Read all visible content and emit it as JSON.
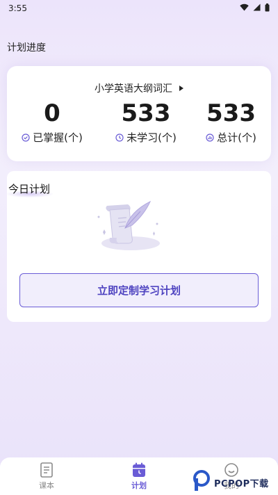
{
  "status_bar": {
    "time": "3:55",
    "icons": [
      "wifi-icon",
      "cellular-signal-icon",
      "battery-icon"
    ]
  },
  "progress_section": {
    "title": "计划进度",
    "book_name": "小学英语大纲词汇",
    "stats": [
      {
        "value": "0",
        "label": "已掌握(个)",
        "icon": "check-circle-icon"
      },
      {
        "value": "533",
        "label": "未学习(个)",
        "icon": "clock-icon"
      },
      {
        "value": "533",
        "label": "总计(个)",
        "icon": "bar-chart-icon"
      }
    ]
  },
  "today_plan": {
    "title": "今日计划",
    "illustration": "scroll-quill-icon",
    "button_label": "立即定制学习计划"
  },
  "bottom_nav": {
    "items": [
      {
        "label": "课本",
        "icon": "book-icon",
        "active": false
      },
      {
        "label": "计划",
        "icon": "calendar-icon",
        "active": true
      },
      {
        "label": "我的",
        "icon": "smiley-icon",
        "active": false
      }
    ]
  },
  "watermark": {
    "text": "PCPOP下载"
  },
  "colors": {
    "accent": "#6a5cd6",
    "accent_text": "#4e43c0",
    "button_bg": "#f1eefc",
    "page_bg": "#efe9fb"
  }
}
